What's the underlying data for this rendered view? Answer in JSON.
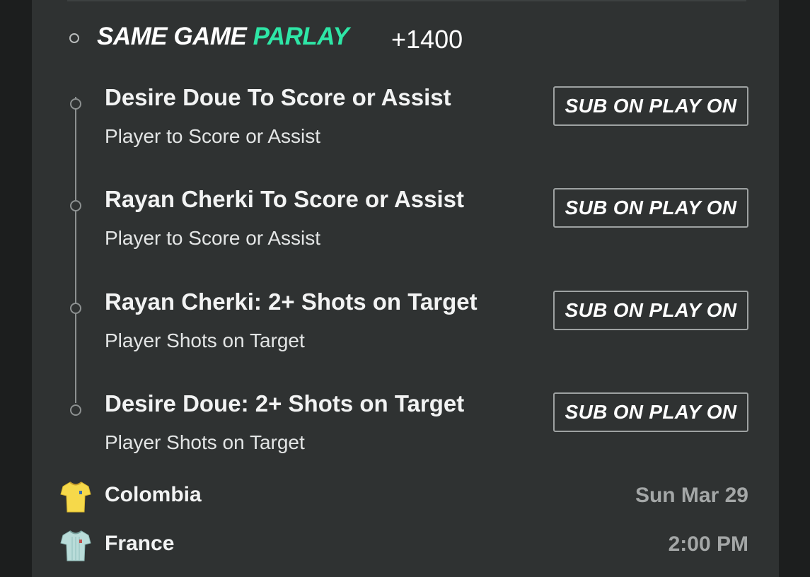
{
  "parlay": {
    "title_part1": "SAME GAME ",
    "title_part2": "PARLAY",
    "odds": "+1400",
    "accent_color": "#2ee6a6"
  },
  "legs": [
    {
      "title": "Desire Doue To Score or Assist",
      "market": "Player to Score or Assist",
      "button_label": "SUB ON PLAY ON"
    },
    {
      "title": "Rayan Cherki To Score or Assist",
      "market": "Player to Score or Assist",
      "button_label": "SUB ON PLAY ON"
    },
    {
      "title": "Rayan Cherki: 2+ Shots on Target",
      "market": "Player Shots on Target",
      "button_label": "SUB ON PLAY ON"
    },
    {
      "title": "Desire Doue: 2+ Shots on Target",
      "market": "Player Shots on Target",
      "button_label": "SUB ON PLAY ON"
    }
  ],
  "match": {
    "teams": [
      {
        "name": "Colombia",
        "meta": "Sun Mar 29",
        "jersey_icon": "yellow-jersey-icon",
        "jersey_color": "#f6d94a"
      },
      {
        "name": "France",
        "meta": "2:00 PM",
        "jersey_icon": "light-blue-jersey-icon",
        "jersey_color": "#b9dcd9"
      }
    ]
  }
}
